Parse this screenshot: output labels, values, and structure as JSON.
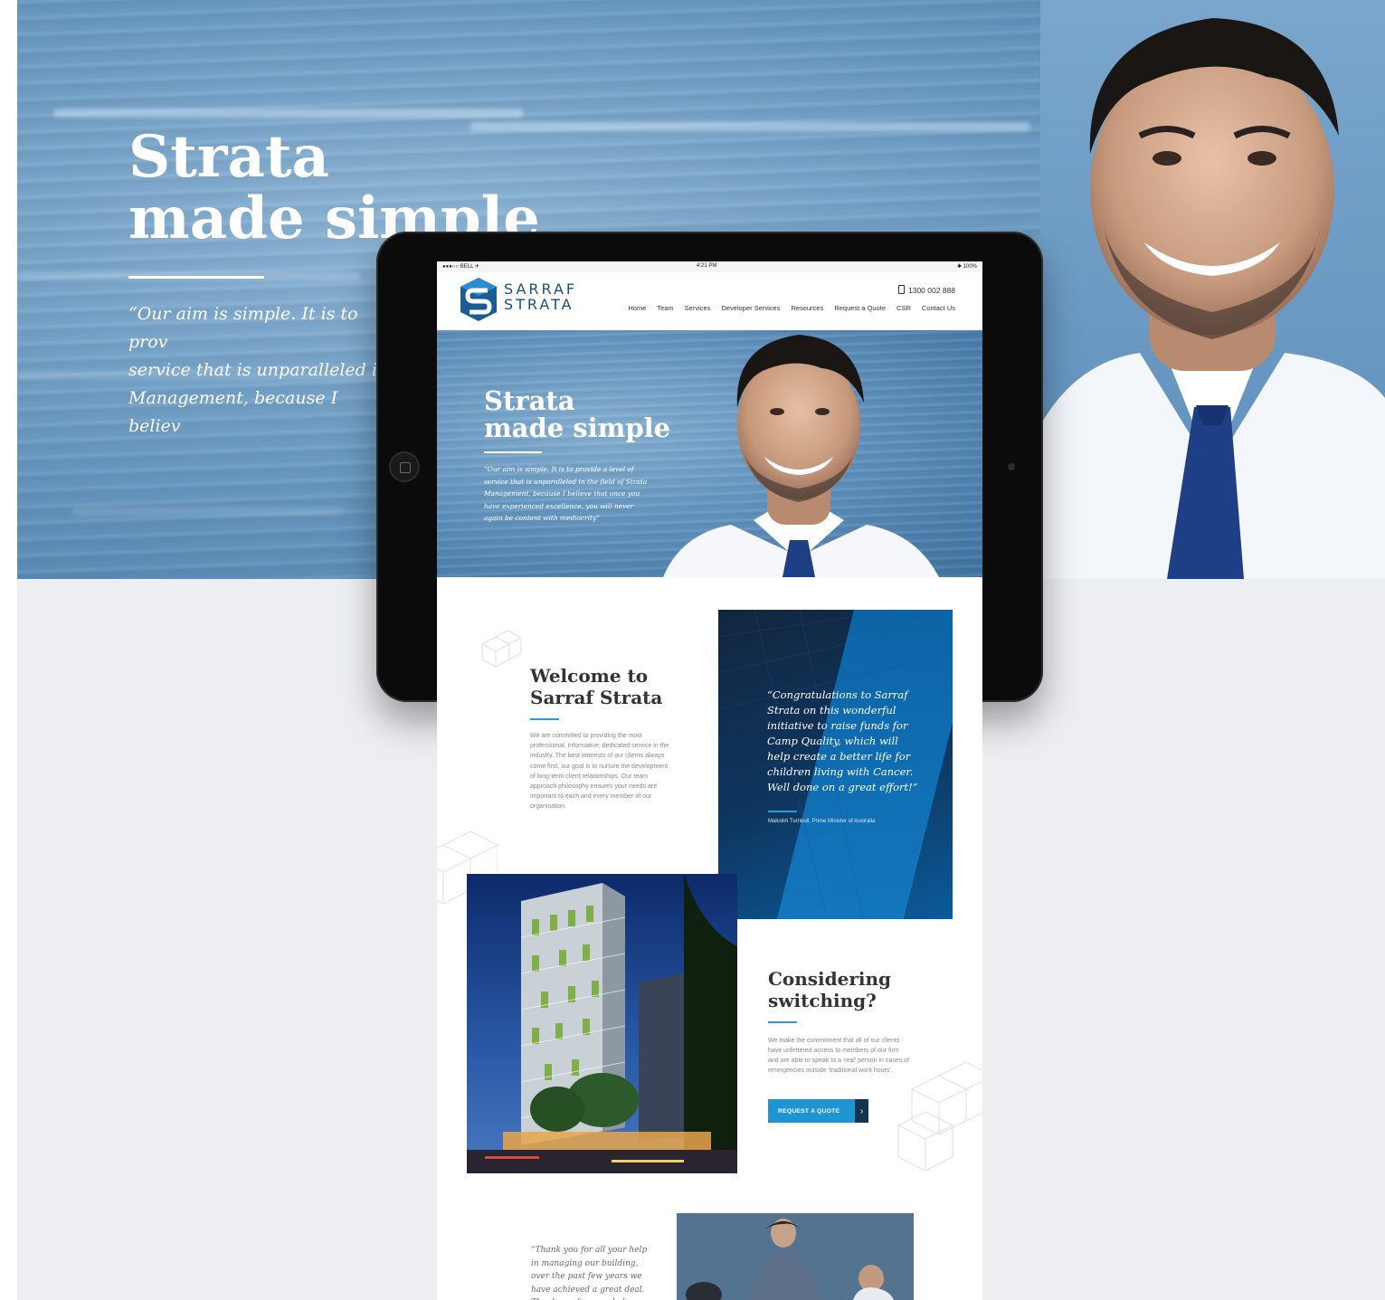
{
  "background": {
    "hero_title": "Strata\nmade simple",
    "hero_quote": "“Our aim is simple. It is to prov\n service that is unparalleled in\n Management, because I believ\n have experienced excellence, y\n again be content with mediocr",
    "colors": {
      "hero_blue": "#6d9cc4",
      "lower_gray": "#edeef2"
    }
  },
  "tablet": {
    "status": {
      "carrier": "●●●○○ BELL ✈",
      "time": "4:21 PM",
      "battery": "✱ 100%"
    }
  },
  "site": {
    "logo": {
      "line1": "SARRAF",
      "line2": "STRATA"
    },
    "phone": "1300 002 888",
    "nav": [
      "Home",
      "Team",
      "Services",
      "Developer Services",
      "Resources",
      "Request a Quote",
      "CSR",
      "Contact Us"
    ],
    "hero": {
      "title": "Strata\nmade simple",
      "quote": "“Our aim is simple. It is to provide a level of\nservice that is unparalleled in the field of Strata\nManagement, because I believe that once you\nhave experienced excellence, you will never\nagain be content with mediocrity”"
    },
    "welcome": {
      "title": "Welcome to\nSarraf Strata",
      "body": "We are committed to providing the most professional, informative, dedicated service in the industry. The best interests of our clients always come first, our goal is to nurture the development of long-term client relationships. Our team approach philosophy ensures your needs are important to each and every member of our organisation."
    },
    "testimonial": {
      "quote": "“Congratulations to Sarraf Strata on this wonderful initiative to raise funds for Camp Quality, which will help create a better life for children living with Cancer. Well done on a great effort!”",
      "author": "Malcolm Turnbull, Prime Minister of Australia"
    },
    "switching": {
      "title": "Considering\nswitching?",
      "body": "We make the commitment that all of our clients have unfettered access to members of our firm and are able to speak to a 'real' person in cases of emergencies outside 'traditional work hours'.",
      "button": "REQUEST A QUOTE"
    },
    "thanks": {
      "quote": "“Thank you for all your help in managing our building, over the past few years we have achieved a great deal. Thank you for your help"
    },
    "accent_color": "#2d9bd6"
  }
}
